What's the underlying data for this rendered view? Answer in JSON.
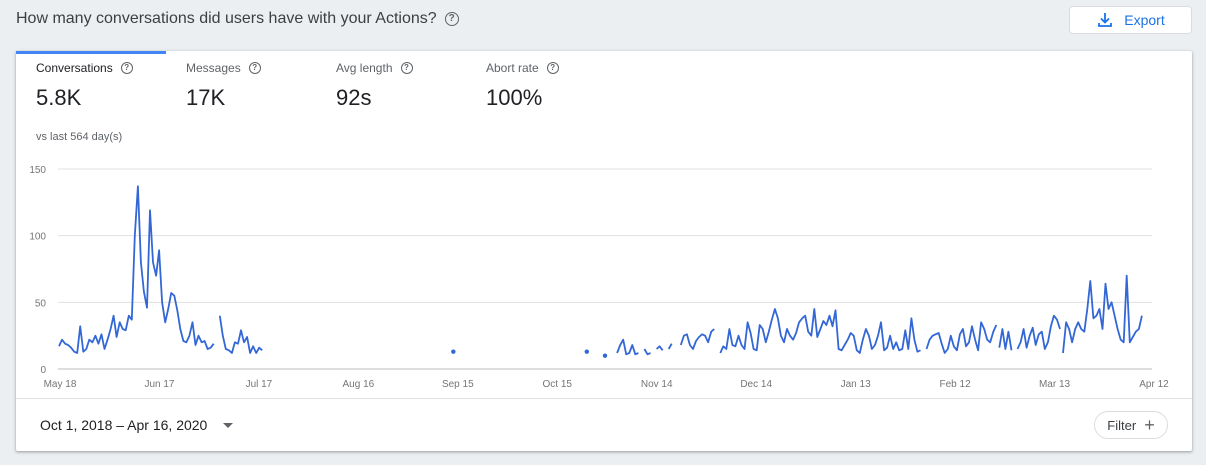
{
  "header": {
    "title": "How many conversations did users have with your Actions?",
    "export_label": "Export"
  },
  "tabs": [
    {
      "label": "Conversations",
      "value": "5.8K",
      "active": true
    },
    {
      "label": "Messages",
      "value": "17K",
      "active": false
    },
    {
      "label": "Avg length",
      "value": "92s",
      "active": false
    },
    {
      "label": "Abort rate",
      "value": "100%",
      "active": false
    }
  ],
  "vs_note": "vs last 564 day(s)",
  "footer": {
    "date_range": "Oct 1, 2018 – Apr 16, 2020",
    "filter_label": "Filter"
  },
  "colors": {
    "accent": "#1a73e8",
    "line": "#3367d6",
    "tab_indicator": "#4285f4"
  },
  "chart_data": {
    "type": "line",
    "y_ticks": [
      0,
      50,
      100,
      150
    ],
    "ylim": [
      0,
      150
    ],
    "x_tick_labels": [
      "May 18",
      "Jun 17",
      "Jul 17",
      "Aug 16",
      "Sep 15",
      "Oct 15",
      "Nov 14",
      "Dec 14",
      "Jan 13",
      "Feb 12",
      "Mar 13",
      "Apr 12"
    ],
    "xlim": [
      0,
      330
    ],
    "series": [
      {
        "segments": [
          [
            [
              0,
              17
            ],
            [
              1,
              22
            ],
            [
              2,
              19
            ],
            [
              3,
              18
            ],
            [
              4,
              16
            ],
            [
              5,
              13
            ],
            [
              6,
              12
            ],
            [
              7,
              32
            ],
            [
              8,
              13
            ],
            [
              9,
              15
            ],
            [
              10,
              22
            ],
            [
              11,
              20
            ],
            [
              12,
              25
            ],
            [
              13,
              19
            ],
            [
              14,
              26
            ],
            [
              15,
              15
            ],
            [
              16,
              22
            ],
            [
              17,
              30
            ],
            [
              18,
              40
            ],
            [
              19,
              24
            ],
            [
              20,
              35
            ],
            [
              21,
              30
            ],
            [
              22,
              29
            ],
            [
              23,
              40
            ],
            [
              24,
              37
            ],
            [
              25,
              100
            ],
            [
              26,
              137
            ],
            [
              27,
              80
            ],
            [
              28,
              58
            ],
            [
              29,
              46
            ],
            [
              30,
              119
            ],
            [
              31,
              80
            ],
            [
              32,
              70
            ],
            [
              33,
              89
            ],
            [
              34,
              50
            ],
            [
              35,
              35
            ],
            [
              36,
              45
            ],
            [
              37,
              57
            ],
            [
              38,
              55
            ],
            [
              39,
              44
            ],
            [
              40,
              30
            ],
            [
              41,
              21
            ],
            [
              42,
              20
            ],
            [
              43,
              25
            ],
            [
              44,
              35
            ],
            [
              45,
              18
            ],
            [
              46,
              25
            ],
            [
              47,
              20
            ],
            [
              48,
              21
            ],
            [
              49,
              15
            ],
            [
              50,
              16
            ],
            [
              51,
              19
            ]
          ],
          [
            [
              53,
              40
            ],
            [
              54,
              25
            ],
            [
              55,
              15
            ],
            [
              56,
              14
            ],
            [
              57,
              12
            ],
            [
              58,
              20
            ],
            [
              59,
              19
            ],
            [
              60,
              29
            ],
            [
              61,
              20
            ],
            [
              62,
              24
            ],
            [
              63,
              12
            ],
            [
              64,
              17
            ],
            [
              65,
              12
            ],
            [
              66,
              16
            ],
            [
              67,
              14
            ]
          ],
          [
            [
              184,
              12
            ],
            [
              185,
              18
            ],
            [
              186,
              22
            ],
            [
              187,
              11
            ],
            [
              188,
              12
            ],
            [
              189,
              18
            ],
            [
              190,
              11
            ],
            [
              191,
              12
            ]
          ],
          [
            [
              193,
              15
            ],
            [
              194,
              11
            ],
            [
              195,
              12
            ]
          ],
          [
            [
              197,
              15
            ],
            [
              198,
              17
            ],
            [
              199,
              14
            ]
          ],
          [
            [
              201,
              15
            ],
            [
              202,
              19
            ]
          ],
          [
            [
              205,
              18
            ],
            [
              206,
              25
            ],
            [
              207,
              26
            ],
            [
              208,
              18
            ],
            [
              209,
              15
            ],
            [
              210,
              21
            ],
            [
              211,
              24
            ],
            [
              212,
              26
            ],
            [
              213,
              25
            ],
            [
              214,
              20
            ],
            [
              215,
              28
            ],
            [
              216,
              30
            ]
          ],
          [
            [
              218,
              12
            ],
            [
              219,
              17
            ],
            [
              220,
              15
            ],
            [
              221,
              30
            ],
            [
              222,
              18
            ],
            [
              223,
              17
            ],
            [
              224,
              25
            ],
            [
              225,
              18
            ],
            [
              226,
              15
            ],
            [
              227,
              35
            ],
            [
              228,
              27
            ],
            [
              229,
              15
            ],
            [
              230,
              14
            ],
            [
              231,
              33
            ],
            [
              232,
              30
            ],
            [
              233,
              20
            ],
            [
              234,
              28
            ],
            [
              235,
              37
            ],
            [
              236,
              45
            ],
            [
              237,
              38
            ],
            [
              238,
              25
            ],
            [
              239,
              20
            ],
            [
              240,
              30
            ],
            [
              241,
              25
            ],
            [
              242,
              22
            ],
            [
              243,
              27
            ],
            [
              244,
              35
            ],
            [
              245,
              38
            ],
            [
              246,
              40
            ],
            [
              247,
              28
            ],
            [
              248,
              25
            ],
            [
              249,
              45
            ],
            [
              250,
              24
            ],
            [
              251,
              30
            ],
            [
              252,
              36
            ],
            [
              253,
              33
            ],
            [
              254,
              40
            ],
            [
              255,
              32
            ],
            [
              256,
              44
            ],
            [
              257,
              15
            ],
            [
              258,
              14
            ],
            [
              259,
              18
            ],
            [
              260,
              22
            ],
            [
              261,
              27
            ],
            [
              262,
              25
            ],
            [
              263,
              14
            ],
            [
              264,
              12
            ],
            [
              265,
              22
            ],
            [
              266,
              30
            ],
            [
              267,
              25
            ],
            [
              268,
              15
            ],
            [
              269,
              18
            ],
            [
              270,
              25
            ],
            [
              271,
              35
            ],
            [
              272,
              14
            ],
            [
              273,
              16
            ],
            [
              274,
              25
            ],
            [
              275,
              15
            ],
            [
              276,
              20
            ],
            [
              277,
              14
            ],
            [
              278,
              15
            ],
            [
              279,
              29
            ],
            [
              280,
              15
            ],
            [
              281,
              38
            ],
            [
              282,
              22
            ],
            [
              283,
              13
            ],
            [
              284,
              14
            ]
          ],
          [
            [
              286,
              15
            ],
            [
              287,
              22
            ],
            [
              288,
              25
            ],
            [
              289,
              26
            ],
            [
              290,
              27
            ],
            [
              291,
              19
            ],
            [
              292,
              12
            ],
            [
              293,
              15
            ],
            [
              294,
              25
            ],
            [
              295,
              17
            ],
            [
              296,
              14
            ],
            [
              297,
              26
            ],
            [
              298,
              30
            ],
            [
              299,
              17
            ],
            [
              300,
              20
            ],
            [
              301,
              32
            ],
            [
              302,
              22
            ],
            [
              303,
              14
            ],
            [
              304,
              35
            ],
            [
              305,
              30
            ],
            [
              306,
              22
            ],
            [
              307,
              20
            ],
            [
              308,
              28
            ],
            [
              309,
              33
            ]
          ],
          [
            [
              310,
              16
            ],
            [
              311,
              30
            ],
            [
              312,
              15
            ],
            [
              313,
              28
            ],
            [
              314,
              14
            ]
          ],
          [
            [
              316,
              15
            ],
            [
              317,
              20
            ],
            [
              318,
              30
            ],
            [
              319,
              16
            ],
            [
              320,
              25
            ],
            [
              321,
              31
            ],
            [
              322,
              18
            ],
            [
              323,
              26
            ],
            [
              324,
              28
            ],
            [
              325,
              15
            ],
            [
              326,
              20
            ],
            [
              327,
              32
            ],
            [
              328,
              40
            ],
            [
              329,
              37
            ],
            [
              330,
              30
            ]
          ],
          [
            [
              331,
              12
            ],
            [
              332,
              35
            ],
            [
              333,
              30
            ],
            [
              334,
              20
            ],
            [
              335,
              30
            ],
            [
              336,
              35
            ],
            [
              337,
              30
            ],
            [
              338,
              28
            ],
            [
              339,
              45
            ],
            [
              340,
              66
            ],
            [
              341,
              38
            ],
            [
              342,
              40
            ],
            [
              343,
              45
            ],
            [
              344,
              30
            ],
            [
              345,
              64
            ],
            [
              346,
              45
            ],
            [
              347,
              50
            ],
            [
              348,
              40
            ],
            [
              349,
              30
            ],
            [
              350,
              22
            ],
            [
              351,
              20
            ],
            [
              352,
              70
            ],
            [
              353,
              20
            ],
            [
              354,
              24
            ],
            [
              355,
              28
            ],
            [
              356,
              30
            ],
            [
              357,
              40
            ]
          ]
        ],
        "points": [
          [
            130,
            13
          ],
          [
            174,
            13
          ],
          [
            180,
            10
          ]
        ]
      }
    ]
  }
}
